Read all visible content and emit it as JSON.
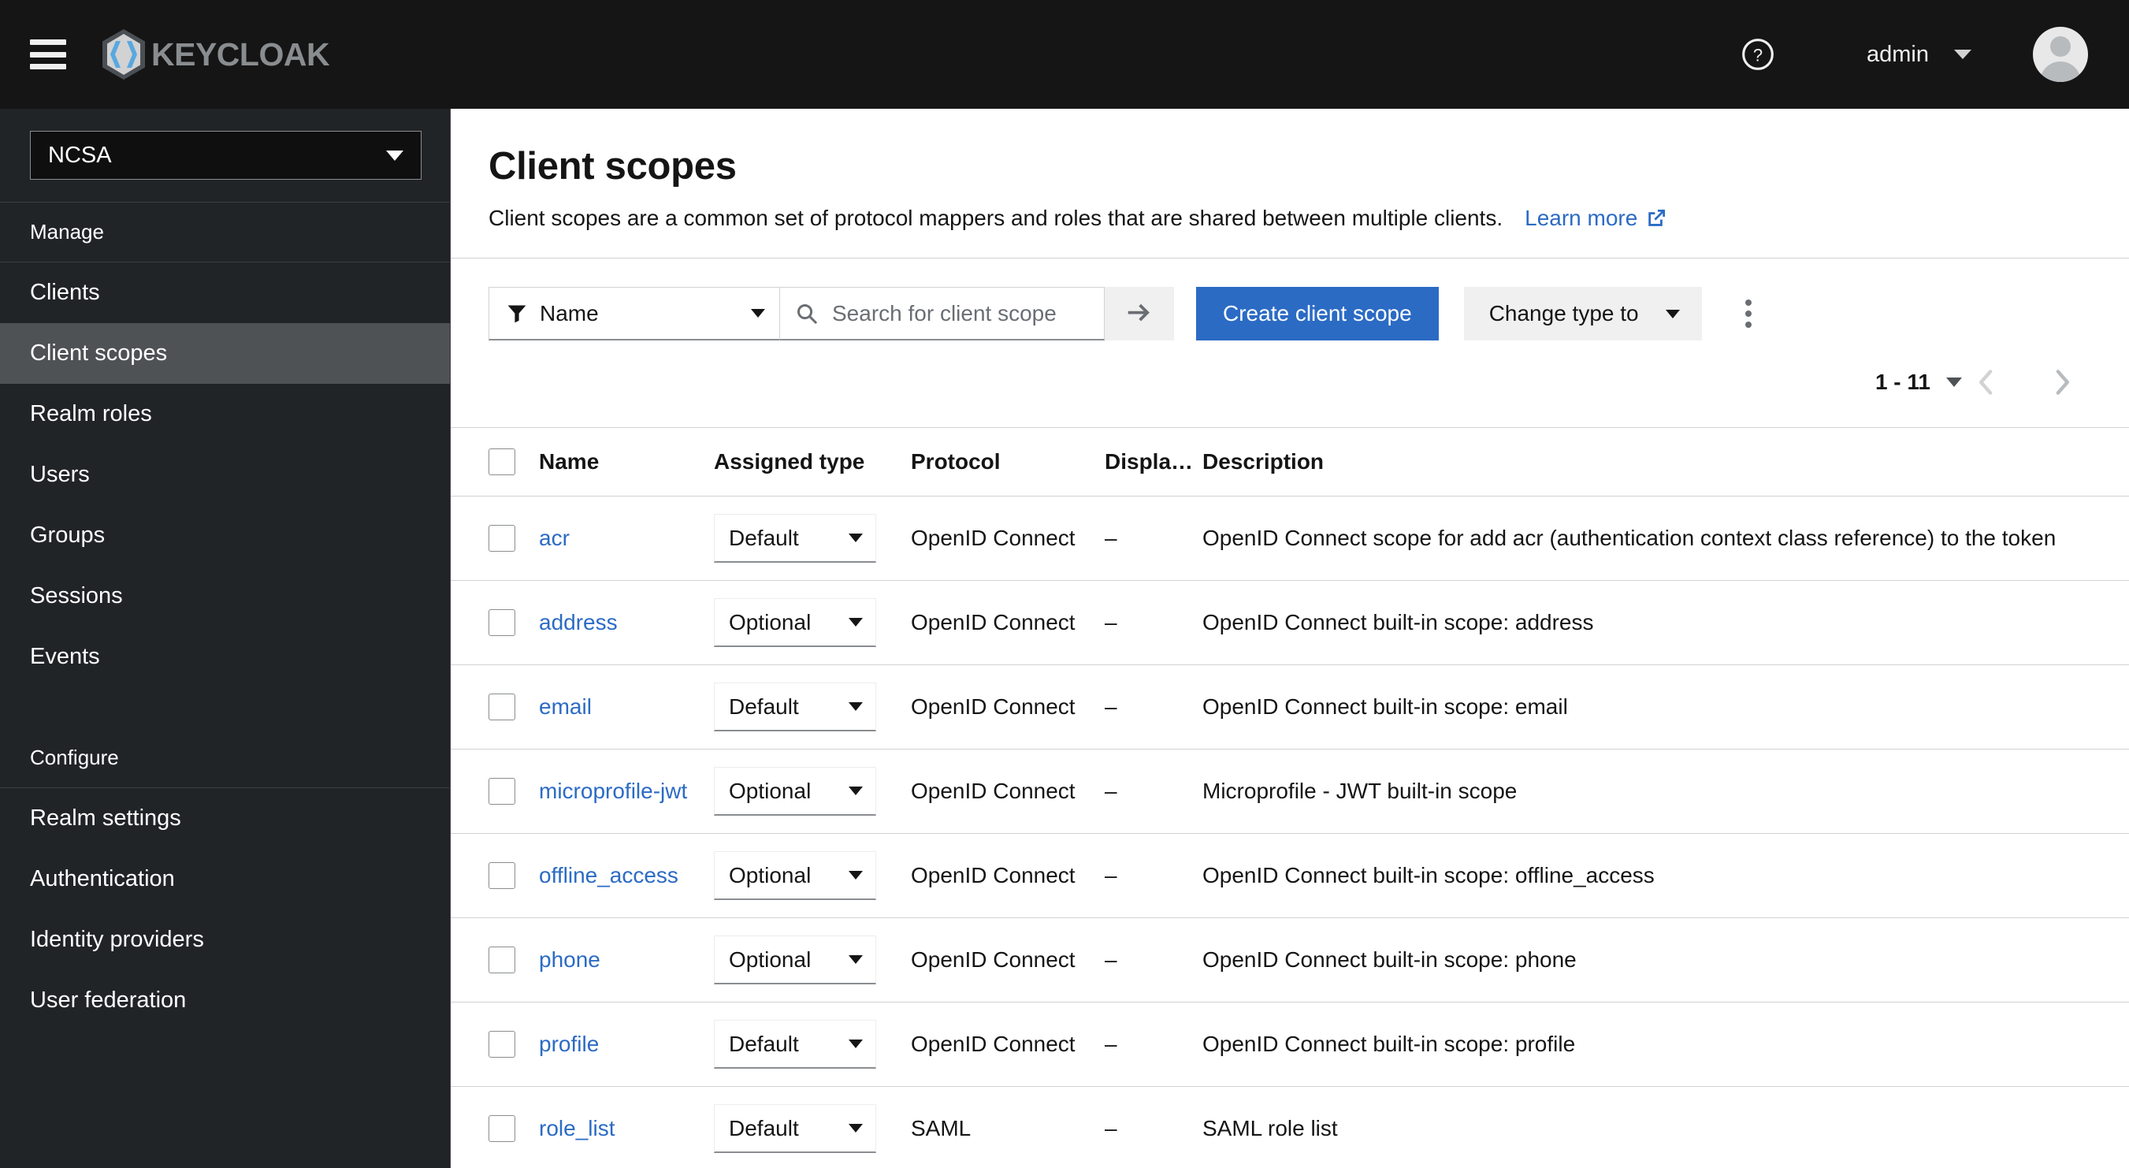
{
  "masthead": {
    "menu_toggle": "Global navigation",
    "brand_text": "KEYCLOAK",
    "help_label": "?",
    "user_name": "admin"
  },
  "sidebar": {
    "realm": {
      "selected": "NCSA"
    },
    "groups": [
      {
        "title": "Manage",
        "items": [
          {
            "label": "Clients",
            "active": false
          },
          {
            "label": "Client scopes",
            "active": true
          },
          {
            "label": "Realm roles",
            "active": false
          },
          {
            "label": "Users",
            "active": false
          },
          {
            "label": "Groups",
            "active": false
          },
          {
            "label": "Sessions",
            "active": false
          },
          {
            "label": "Events",
            "active": false
          }
        ]
      },
      {
        "title": "Configure",
        "items": [
          {
            "label": "Realm settings",
            "active": false
          },
          {
            "label": "Authentication",
            "active": false
          },
          {
            "label": "Identity providers",
            "active": false
          },
          {
            "label": "User federation",
            "active": false
          }
        ]
      }
    ]
  },
  "page": {
    "title": "Client scopes",
    "subtitle": "Client scopes are a common set of protocol mappers and roles that are shared between multiple clients.",
    "learn_more": "Learn more"
  },
  "toolbar": {
    "filter_label": "Name",
    "search_placeholder": "Search for client scope",
    "search_value": "",
    "create_button": "Create client scope",
    "change_type_label": "Change type to"
  },
  "pagination": {
    "range": "1 - 11"
  },
  "table": {
    "columns": [
      "Name",
      "Assigned type",
      "Protocol",
      "Displa…",
      "Description"
    ],
    "rows": [
      {
        "name": "acr",
        "assigned_type": "Default",
        "protocol": "OpenID Connect",
        "display_on_consent": "–",
        "description": "OpenID Connect scope for add acr (authentication context class reference) to the token"
      },
      {
        "name": "address",
        "assigned_type": "Optional",
        "protocol": "OpenID Connect",
        "display_on_consent": "–",
        "description": "OpenID Connect built-in scope: address"
      },
      {
        "name": "email",
        "assigned_type": "Default",
        "protocol": "OpenID Connect",
        "display_on_consent": "–",
        "description": "OpenID Connect built-in scope: email"
      },
      {
        "name": "microprofile-jwt",
        "assigned_type": "Optional",
        "protocol": "OpenID Connect",
        "display_on_consent": "–",
        "description": "Microprofile - JWT built-in scope"
      },
      {
        "name": "offline_access",
        "assigned_type": "Optional",
        "protocol": "OpenID Connect",
        "display_on_consent": "–",
        "description": "OpenID Connect built-in scope: offline_access"
      },
      {
        "name": "phone",
        "assigned_type": "Optional",
        "protocol": "OpenID Connect",
        "display_on_consent": "–",
        "description": "OpenID Connect built-in scope: phone"
      },
      {
        "name": "profile",
        "assigned_type": "Default",
        "protocol": "OpenID Connect",
        "display_on_consent": "–",
        "description": "OpenID Connect built-in scope: profile"
      },
      {
        "name": "role_list",
        "assigned_type": "Default",
        "protocol": "SAML",
        "display_on_consent": "–",
        "description": "SAML role list"
      }
    ]
  },
  "colors": {
    "masthead_bg": "#151515",
    "sidebar_bg": "#212427",
    "sidebar_active": "#4f5255",
    "accent_blue": "#2b6bc4",
    "link_blue": "#2b6bc4",
    "logo_blue": "#59a8e0"
  }
}
